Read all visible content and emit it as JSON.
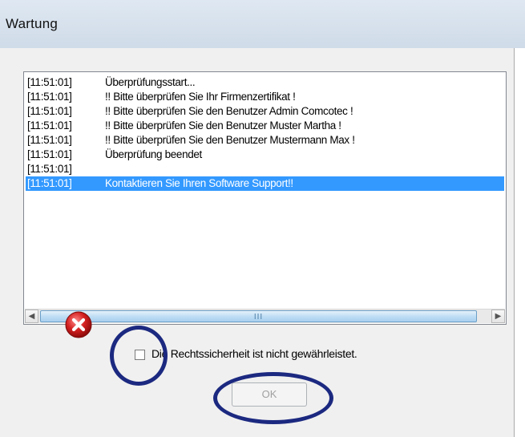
{
  "window": {
    "title": "Wartung"
  },
  "log": {
    "rows": [
      {
        "time": "[11:51:01]",
        "message": "Überprüfungsstart..."
      },
      {
        "time": "[11:51:01]",
        "message": "!! Bitte überprüfen Sie Ihr Firmenzertifikat !"
      },
      {
        "time": "[11:51:01]",
        "message": "!! Bitte überprüfen Sie den Benutzer Admin Comcotec !"
      },
      {
        "time": "[11:51:01]",
        "message": "!! Bitte überprüfen Sie den Benutzer Muster Martha !"
      },
      {
        "time": "[11:51:01]",
        "message": "!! Bitte überprüfen Sie den Benutzer Mustermann Max !"
      },
      {
        "time": "[11:51:01]",
        "message": "Überprüfung beendet"
      },
      {
        "time": "[11:51:01]",
        "message": ""
      },
      {
        "time": "[11:51:01]",
        "message": "Kontaktieren Sie Ihren Software Support!!"
      }
    ],
    "selected_index": 7
  },
  "scrollbar": {
    "grip": "III"
  },
  "icons": {
    "error": "error-icon",
    "scroll_left": "arrow-left-icon",
    "scroll_right": "arrow-right-icon"
  },
  "checkbox": {
    "label": "Die Rechtssicherheit ist nicht gewährleistet.",
    "checked": false
  },
  "ok_button": {
    "label": "OK",
    "enabled": false
  },
  "colors": {
    "selection": "#3399ff",
    "annotation_ring": "#1c2980",
    "error_red": "#d42020"
  }
}
